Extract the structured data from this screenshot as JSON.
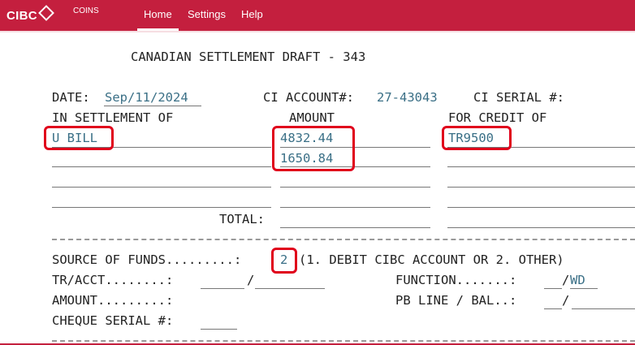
{
  "app": {
    "brand": "CIBC",
    "subtitle": "COINS",
    "nav": [
      "Home",
      "Settings",
      "Help"
    ],
    "colors": {
      "brand": "#c41f3e",
      "field_value": "#3a6f86",
      "highlight": "#e0001b"
    }
  },
  "form": {
    "title": "CANADIAN SETTLEMENT DRAFT - 343",
    "date_label": "DATE:",
    "date_value": "Sep/11/2024",
    "account_label": "CI ACCOUNT#:",
    "account_value": "27-43043",
    "serial_label": "CI SERIAL #:",
    "col_settlement": "IN SETTLEMENT OF",
    "col_amount": "AMOUNT",
    "col_credit": "FOR CREDIT OF",
    "row1_settlement": "U BILL",
    "amount1": "4832.44",
    "amount2": "1650.84",
    "credit1": "TR9500",
    "total_label": "TOTAL:",
    "source_label": "SOURCE OF FUNDS.........:",
    "source_value": "2",
    "source_hint": "(1. DEBIT CIBC ACCOUNT OR 2. OTHER)",
    "tracct_label": "TR/ACCT........:",
    "tracct_sep": "/",
    "function_label": "FUNCTION.......:",
    "function_sep": "/",
    "function_value": "WD",
    "amount_label": "AMOUNT.........:",
    "pbline_label": "PB LINE / BAL..:",
    "pbline_sep": "/",
    "cheque_label": "CHEQUE SERIAL #:"
  }
}
